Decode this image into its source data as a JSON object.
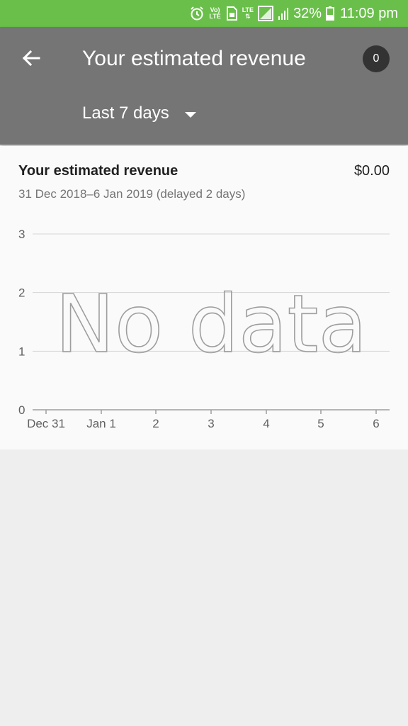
{
  "status_bar": {
    "volte_top": "Vo)",
    "volte_bottom": "LTE",
    "lte_label": "LTE",
    "battery_pct": "32%",
    "time": "11:09 pm",
    "icons": [
      "alarm-icon",
      "volte-icon",
      "sim-icon",
      "lte-icon",
      "signal-icon",
      "battery-icon"
    ]
  },
  "app_bar": {
    "back_icon": "arrow-back-icon",
    "title": "Your estimated revenue",
    "notification_count": "0",
    "range_label": "Last 7 days",
    "range_icon": "dropdown-caret-icon"
  },
  "card": {
    "title": "Your estimated revenue",
    "amount": "$0.00",
    "subtitle": "31 Dec 2018–6 Jan 2019 (delayed 2 days)"
  },
  "chart_data": {
    "type": "line",
    "x_categories": [
      "Dec 31",
      "Jan 1",
      "2",
      "3",
      "4",
      "5",
      "6"
    ],
    "y_ticks": [
      "0",
      "1",
      "2",
      "3"
    ],
    "ylim": [
      0,
      3
    ],
    "series": [],
    "grid": true,
    "empty_message": "No data"
  },
  "colors": {
    "status_bar": "#6abf4b",
    "app_bar": "#757575",
    "card_bg": "#fafafa",
    "page_bg": "#eeeeee"
  }
}
